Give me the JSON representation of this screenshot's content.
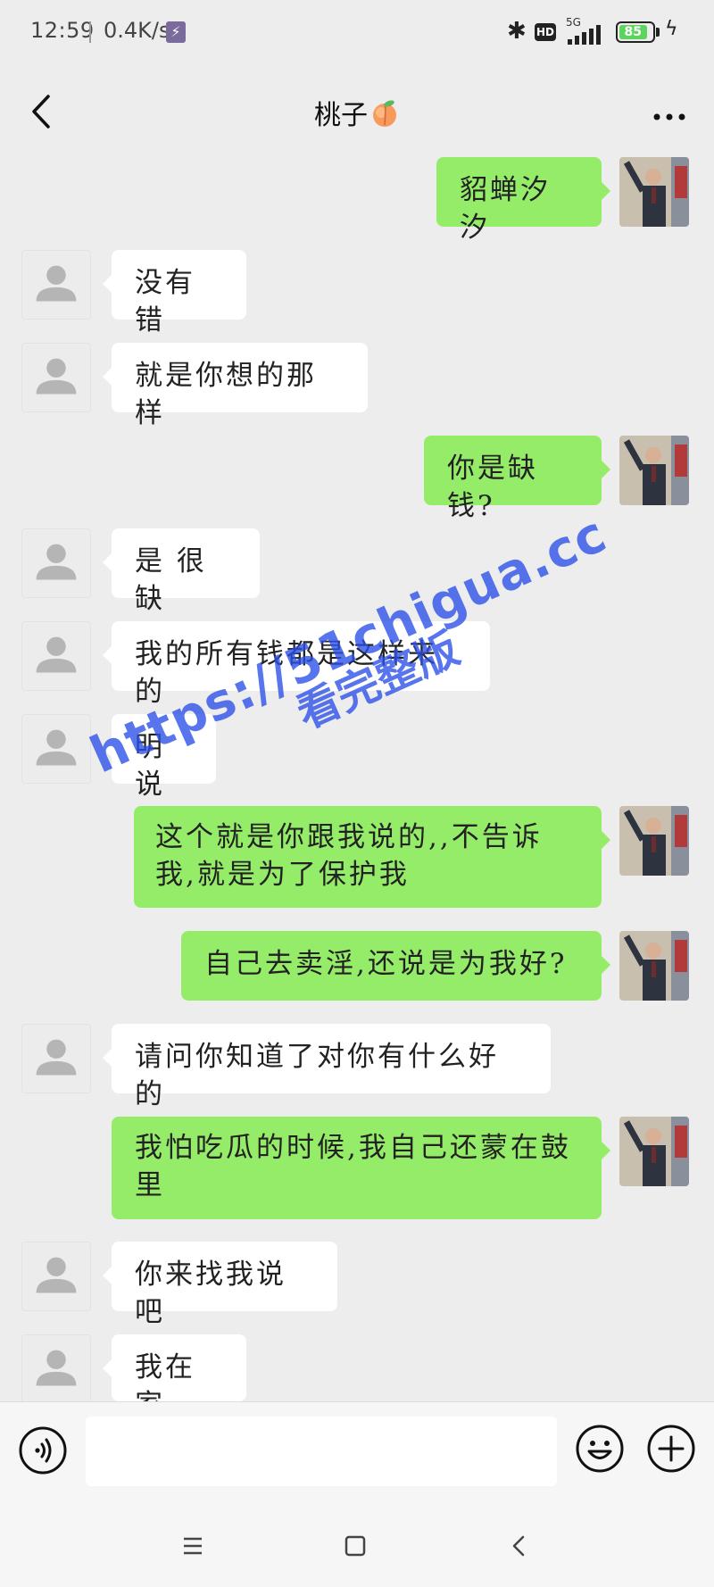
{
  "status_bar": {
    "time": "12:59",
    "speed": "0.4K/s",
    "network_label": "5G",
    "hd_label": "HD",
    "battery_level": "85",
    "battery_fraction": 0.85
  },
  "header": {
    "title": "桃子",
    "title_emoji_icon": "peach-icon",
    "back_icon": "chevron-left-icon",
    "more_icon": "more-dots-icon"
  },
  "messages": [
    {
      "side": "out",
      "text": "貂蝉汐汐"
    },
    {
      "side": "in",
      "text": "没有错"
    },
    {
      "side": "in",
      "text": "就是你想的那样"
    },
    {
      "side": "out",
      "text": "你是缺钱?"
    },
    {
      "side": "in",
      "text": "是 很缺"
    },
    {
      "side": "in",
      "text": "我的所有钱都是这样来的"
    },
    {
      "side": "in",
      "text": "明说"
    },
    {
      "side": "out",
      "text": "这个就是你跟我说的,,不告诉我,就是为了保护我"
    },
    {
      "side": "out",
      "text": "自己去卖淫,还说是为我好?"
    },
    {
      "side": "in",
      "text": "请问你知道了对你有什么好的"
    },
    {
      "side": "out",
      "text": "我怕吃瓜的时候,我自己还蒙在鼓里"
    },
    {
      "side": "in",
      "text": "你来找我说吧"
    },
    {
      "side": "in",
      "text": "我在家"
    }
  ],
  "watermark": {
    "url": "https://51chigua.cc",
    "subtitle": "看完整版"
  },
  "input_bar": {
    "value": "",
    "placeholder": "",
    "voice_icon": "voice-icon",
    "emoji_icon": "emoji-icon",
    "plus_icon": "plus-icon"
  },
  "colors": {
    "background": "#ededed",
    "outgoing_bubble": "#95ec69",
    "incoming_bubble": "#ffffff",
    "watermark": "#2a4fe8"
  }
}
